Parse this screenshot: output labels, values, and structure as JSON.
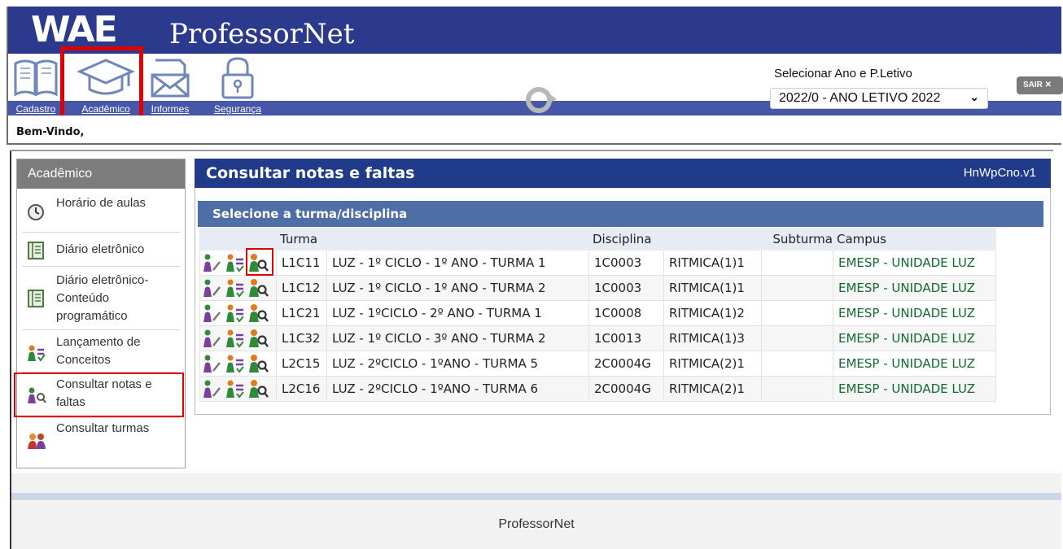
{
  "header": {
    "logo": "WAE",
    "app_title": "ProfessorNet",
    "welcome": "Bem-Vindo,",
    "year_label": "Selecionar Ano e P.Letivo",
    "year_value": "2022/0 - ANO LETIVO 2022",
    "logout": "SAIR ✕",
    "toolbar": [
      {
        "label": "Cadastro",
        "icon": "book-icon"
      },
      {
        "label": "Acadêmico",
        "icon": "graduation-cap-icon"
      },
      {
        "label": "Informes",
        "icon": "envelope-icon"
      },
      {
        "label": "Segurança",
        "icon": "lock-icon"
      }
    ]
  },
  "sidebar": {
    "title": "Acadêmico",
    "items": [
      {
        "label": "Horário de aulas",
        "icon": "clock-icon"
      },
      {
        "label": "Diário eletrônico",
        "icon": "ledger-icon"
      },
      {
        "label": "Diário eletrônico- Conteúdo programático",
        "icon": "ledger-icon"
      },
      {
        "label": "Lançamento de Conceitos",
        "icon": "student-grades-icon"
      },
      {
        "label": "Consultar notas e faltas",
        "icon": "student-search-icon"
      },
      {
        "label": "Consultar turmas",
        "icon": "group-icon"
      }
    ]
  },
  "main": {
    "title": "Consultar notas e faltas",
    "code": "HnWpCno.v1",
    "subtitle": "Selecione a turma/disciplina",
    "columns": {
      "turma": "Turma",
      "disciplina": "Disciplina",
      "subturma": "Subturma",
      "campus": "Campus"
    },
    "rows": [
      {
        "turma": "L1C11",
        "descricao": "LUZ - 1º CICLO - 1º ANO - TURMA 1",
        "disciplina": "1C0003",
        "nome": "RITMICA(1)1",
        "subturma": "",
        "campus": "EMESP - UNIDADE LUZ"
      },
      {
        "turma": "L1C12",
        "descricao": "LUZ - 1º CICLO - 1º ANO - TURMA 2",
        "disciplina": "1C0003",
        "nome": "RITMICA(1)1",
        "subturma": "",
        "campus": "EMESP - UNIDADE LUZ"
      },
      {
        "turma": "L1C21",
        "descricao": "LUZ - 1ºCICLO - 2º ANO - TURMA 1",
        "disciplina": "1C0008",
        "nome": "RITMICA(1)2",
        "subturma": "",
        "campus": "EMESP - UNIDADE LUZ"
      },
      {
        "turma": "L1C32",
        "descricao": "LUZ - 1º CICLO - 3º ANO - TURMA 2",
        "disciplina": "1C0013",
        "nome": "RITMICA(1)3",
        "subturma": "",
        "campus": "EMESP - UNIDADE LUZ"
      },
      {
        "turma": "L2C15",
        "descricao": "LUZ - 2ºCICLO - 1ºANO - TURMA 5",
        "disciplina": "2C0004G",
        "nome": "RITMICA(2)1",
        "subturma": "",
        "campus": "EMESP - UNIDADE LUZ"
      },
      {
        "turma": "L2C16",
        "descricao": "LUZ - 2ºCICLO - 1ºANO - TURMA 6",
        "disciplina": "2C0004G",
        "nome": "RITMICA(2)1",
        "subturma": "",
        "campus": "EMESP - UNIDADE LUZ"
      }
    ],
    "row_icons": [
      "student-pencil-icon",
      "student-grades-icon",
      "student-search-icon"
    ]
  },
  "footer": {
    "text": "ProfessorNet"
  },
  "colors": {
    "header_blue": "#2b3a8c",
    "panel_blue": "#1f3b8a",
    "sub_blue": "#4e6ea6",
    "highlight_red": "#e00000",
    "campus_green": "#126b2d"
  }
}
